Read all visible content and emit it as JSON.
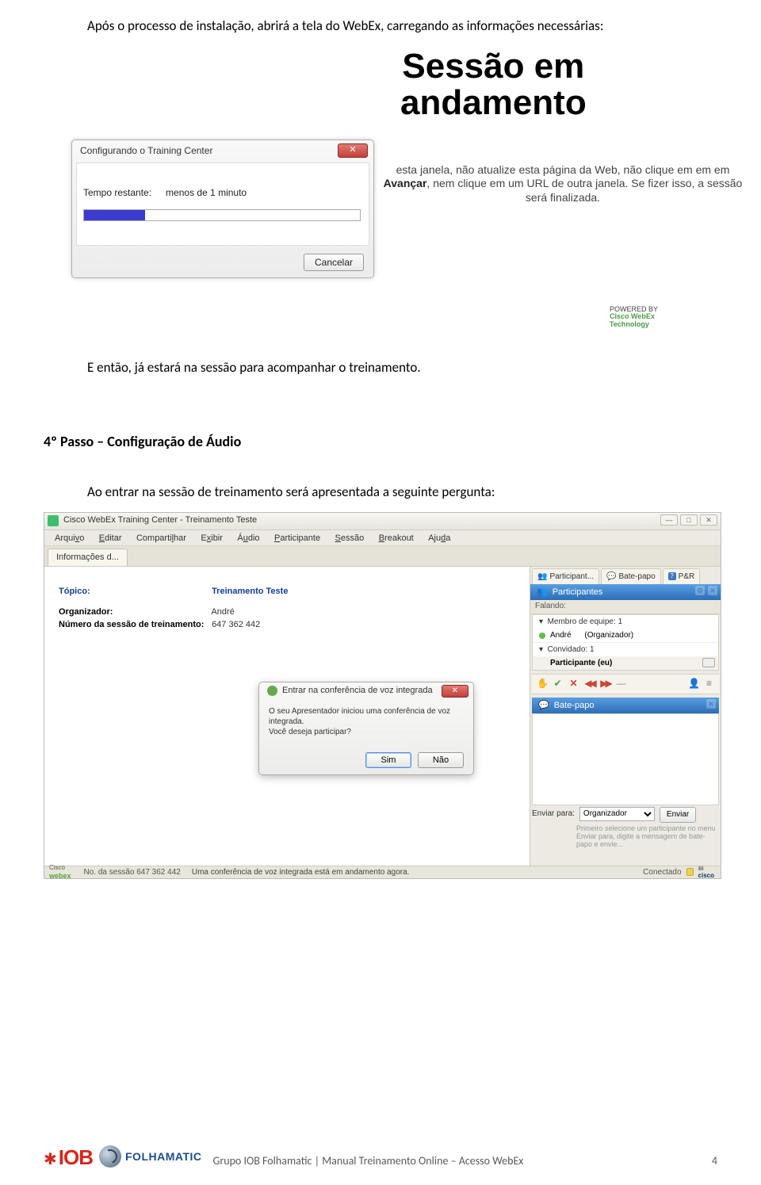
{
  "para1": "Após o processo de instalação, abrirá a tela do WebEx, carregando as informações necessárias:",
  "fig1": {
    "session_title_l1": "Sessão em",
    "session_title_l2": "andamento",
    "desc_part1": " esta janela, não atualize esta página da Web, não clique em em em ",
    "desc_bold": "Avançar",
    "desc_part2": ", nem clique em um URL de outra janela. Se fizer isso, a sessão será finalizada.",
    "dialog_title": "Configurando o Training Center",
    "tempo_label": "Tempo restante:",
    "tempo_value": "menos de 1 minuto",
    "cancel": "Cancelar",
    "close_glyph": "✕",
    "powered1": "POWERED BY",
    "powered2": "Cisco WebEx",
    "powered3": "Technology"
  },
  "para2": "E então, já estará na sessão para acompanhar o treinamento.",
  "heading_step4": "4º Passo – Configuração de Áudio",
  "para3": "Ao entrar na sessão de treinamento será apresentada a seguinte pergunta:",
  "fig2": {
    "window_title": "Cisco WebEx Training Center - Treinamento Teste",
    "menus": [
      "Arquivo",
      "Editar",
      "Compartilhar",
      "Exibir",
      "Áudio",
      "Participante",
      "Sessão",
      "Breakout",
      "Ajuda"
    ],
    "menus_ul": [
      "v",
      "E",
      "l",
      "x",
      "u",
      "P",
      "S",
      "B",
      "d"
    ],
    "subtab": "Informações d...",
    "info": {
      "topic_label": "Tópico:",
      "topic_value": "Treinamento Teste",
      "organizer_label": "Organizador:",
      "organizer_value": "André",
      "session_num_label": "Número da sessão de treinamento:",
      "session_num_value": "647 362 442"
    },
    "panels": {
      "tabs": [
        "Participant...",
        "Bate-papo",
        "P&R"
      ],
      "participants_header": "Participantes",
      "falando": "Falando:",
      "team_group": "Membro de equipe: 1",
      "andre_name": "André",
      "andre_role": "(Organizador)",
      "guest_group": "Convidado: 1",
      "participant_self": "Participante (eu)",
      "chat_header": "Bate-papo",
      "send_to_label": "Enviar para:",
      "send_to_value": "Organizador",
      "send_hint": "Primeiro selecione um participante no menu Enviar para, digite a mensagem de bate-papo e envie...",
      "send_btn": "Enviar"
    },
    "voice": {
      "title": "Entrar na conferência de voz integrada",
      "msg1": "O seu Apresentador iniciou uma conferência de voz integrada.",
      "msg2": "Você deseja participar?",
      "yes": "Sim",
      "no": "Não",
      "close_glyph": "✕"
    },
    "status": {
      "webex_cisco": "Cisco",
      "webex_webex": "webex",
      "session_num": "No. da sessão 647 362 442",
      "conf": "Uma conferência de voz integrada está em andamento agora.",
      "connected": "Conectado",
      "cisco_txt": "cisco"
    },
    "winbtns": [
      "—",
      "□",
      "✕"
    ]
  },
  "footer": {
    "iob": "IOB",
    "folha": "FOLHAMATIC",
    "text": "Grupo IOB Folhamatic | Manual Treinamento Online – Acesso WebEx",
    "page": "4"
  }
}
